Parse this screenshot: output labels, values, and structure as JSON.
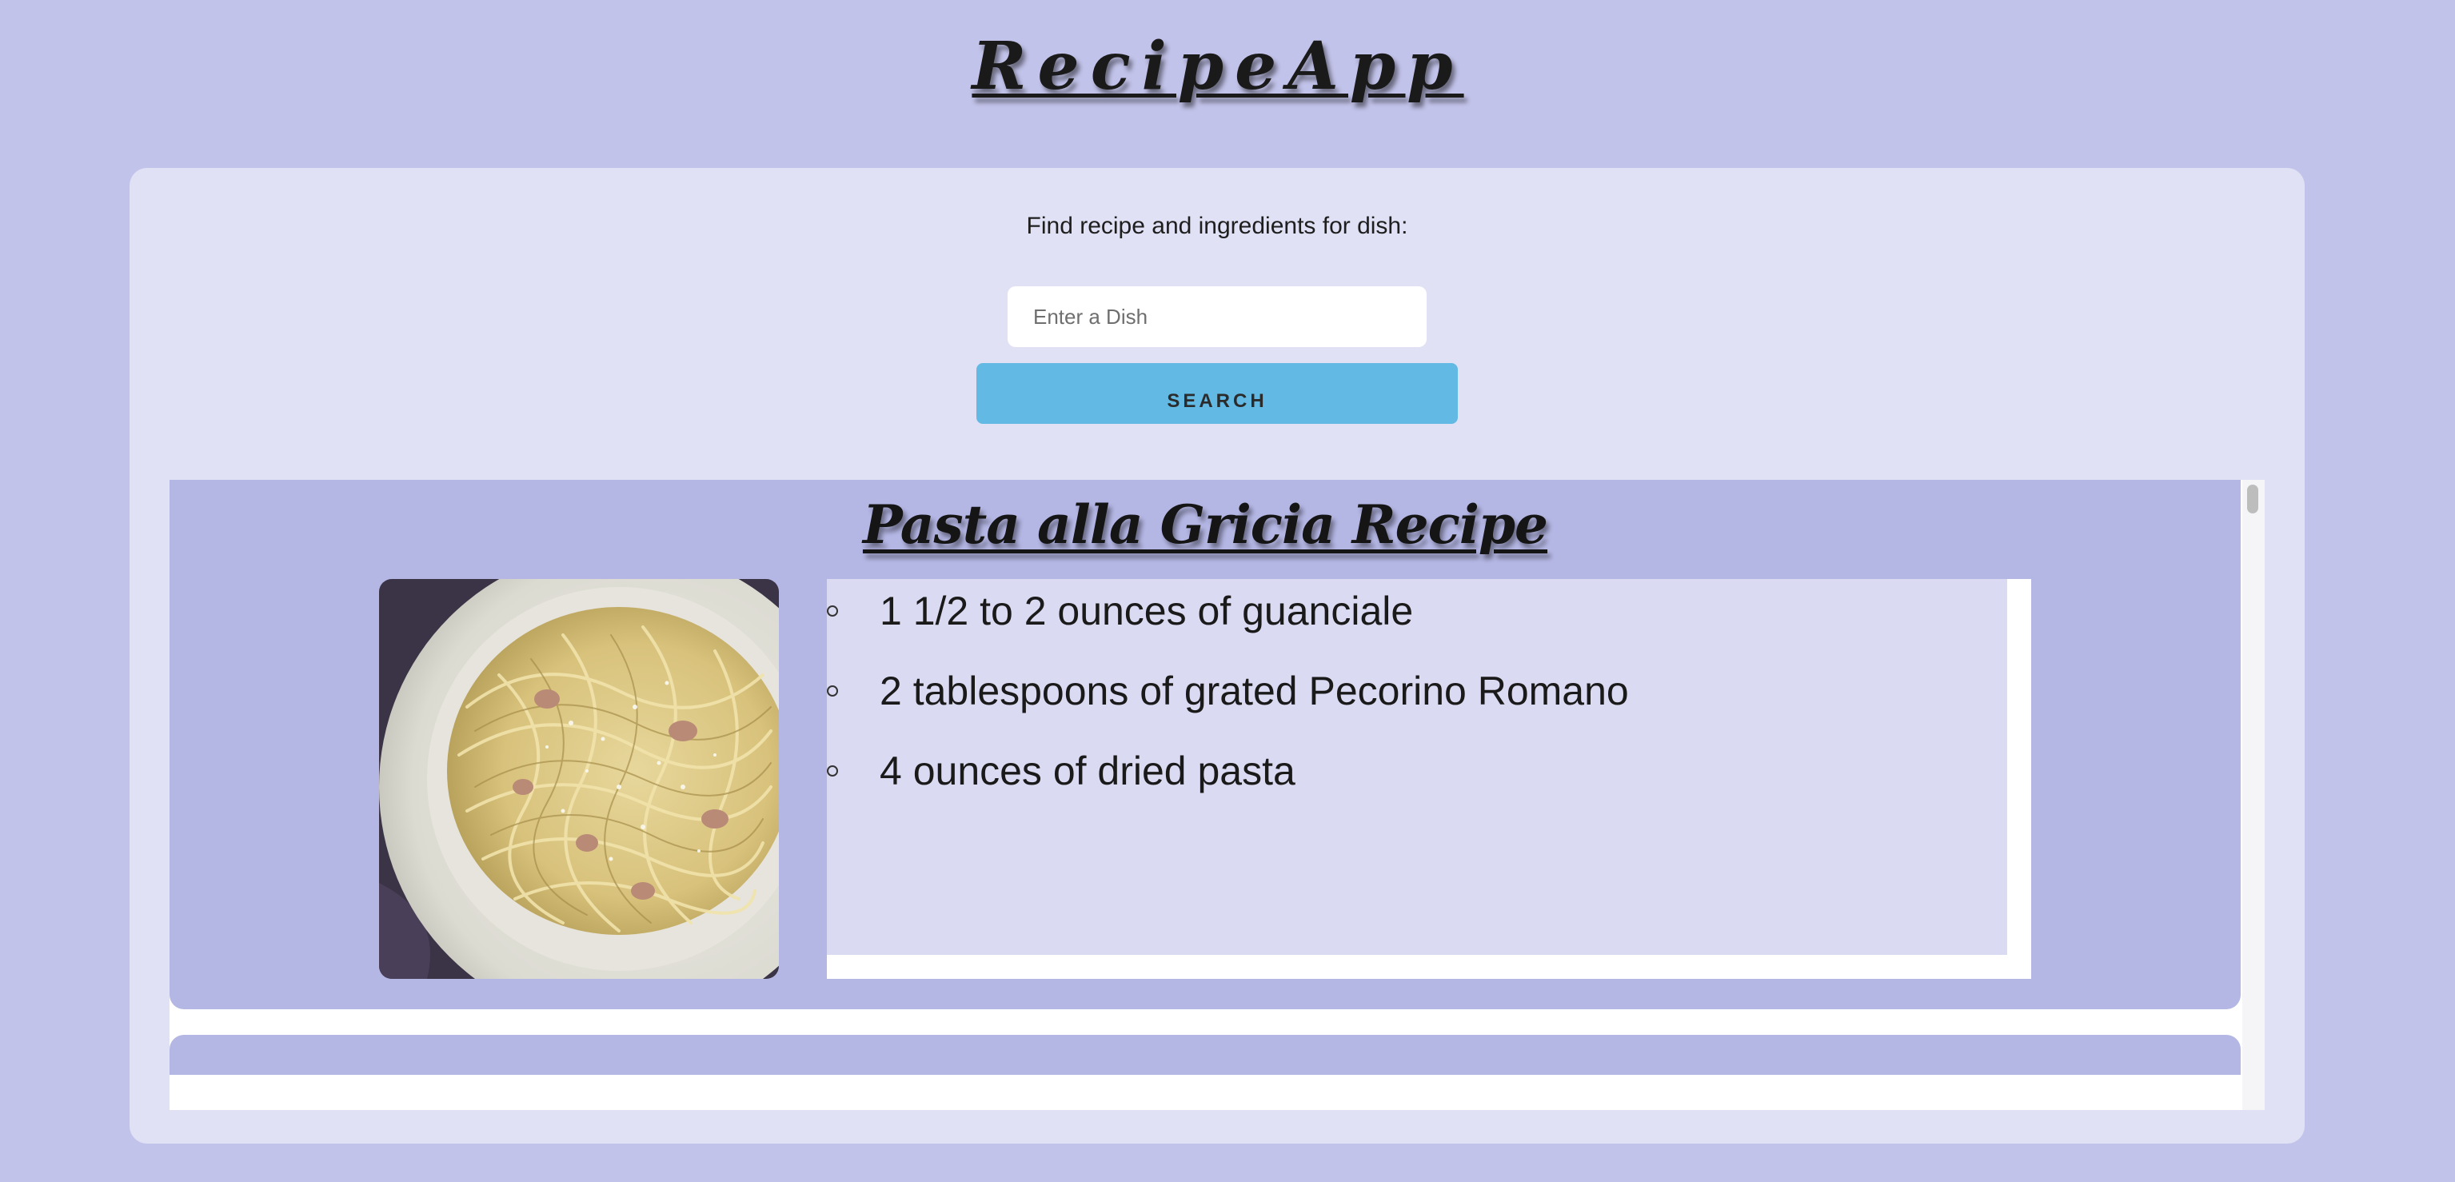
{
  "app": {
    "title": "RecipeApp"
  },
  "search": {
    "prompt": "Find recipe and ingredients for dish:",
    "placeholder": "Enter a Dish",
    "value": "",
    "button_label": "SEARCH"
  },
  "recipe": {
    "title": "Pasta alla Gricia Recipe",
    "image_alt": "plate of spaghetti with guanciale and grated cheese",
    "ingredients": [
      "1 1/2 to 2 ounces of guanciale",
      "2 tablespoons of grated Pecorino Romano",
      "4 ounces of dried pasta"
    ]
  },
  "colors": {
    "page_background": "#c2c3ea",
    "panel_background": "#e0e1f4",
    "card_background": "#b4b6e4",
    "ingredients_background": "#dadaf2",
    "button_accent": "#61b9e4"
  }
}
